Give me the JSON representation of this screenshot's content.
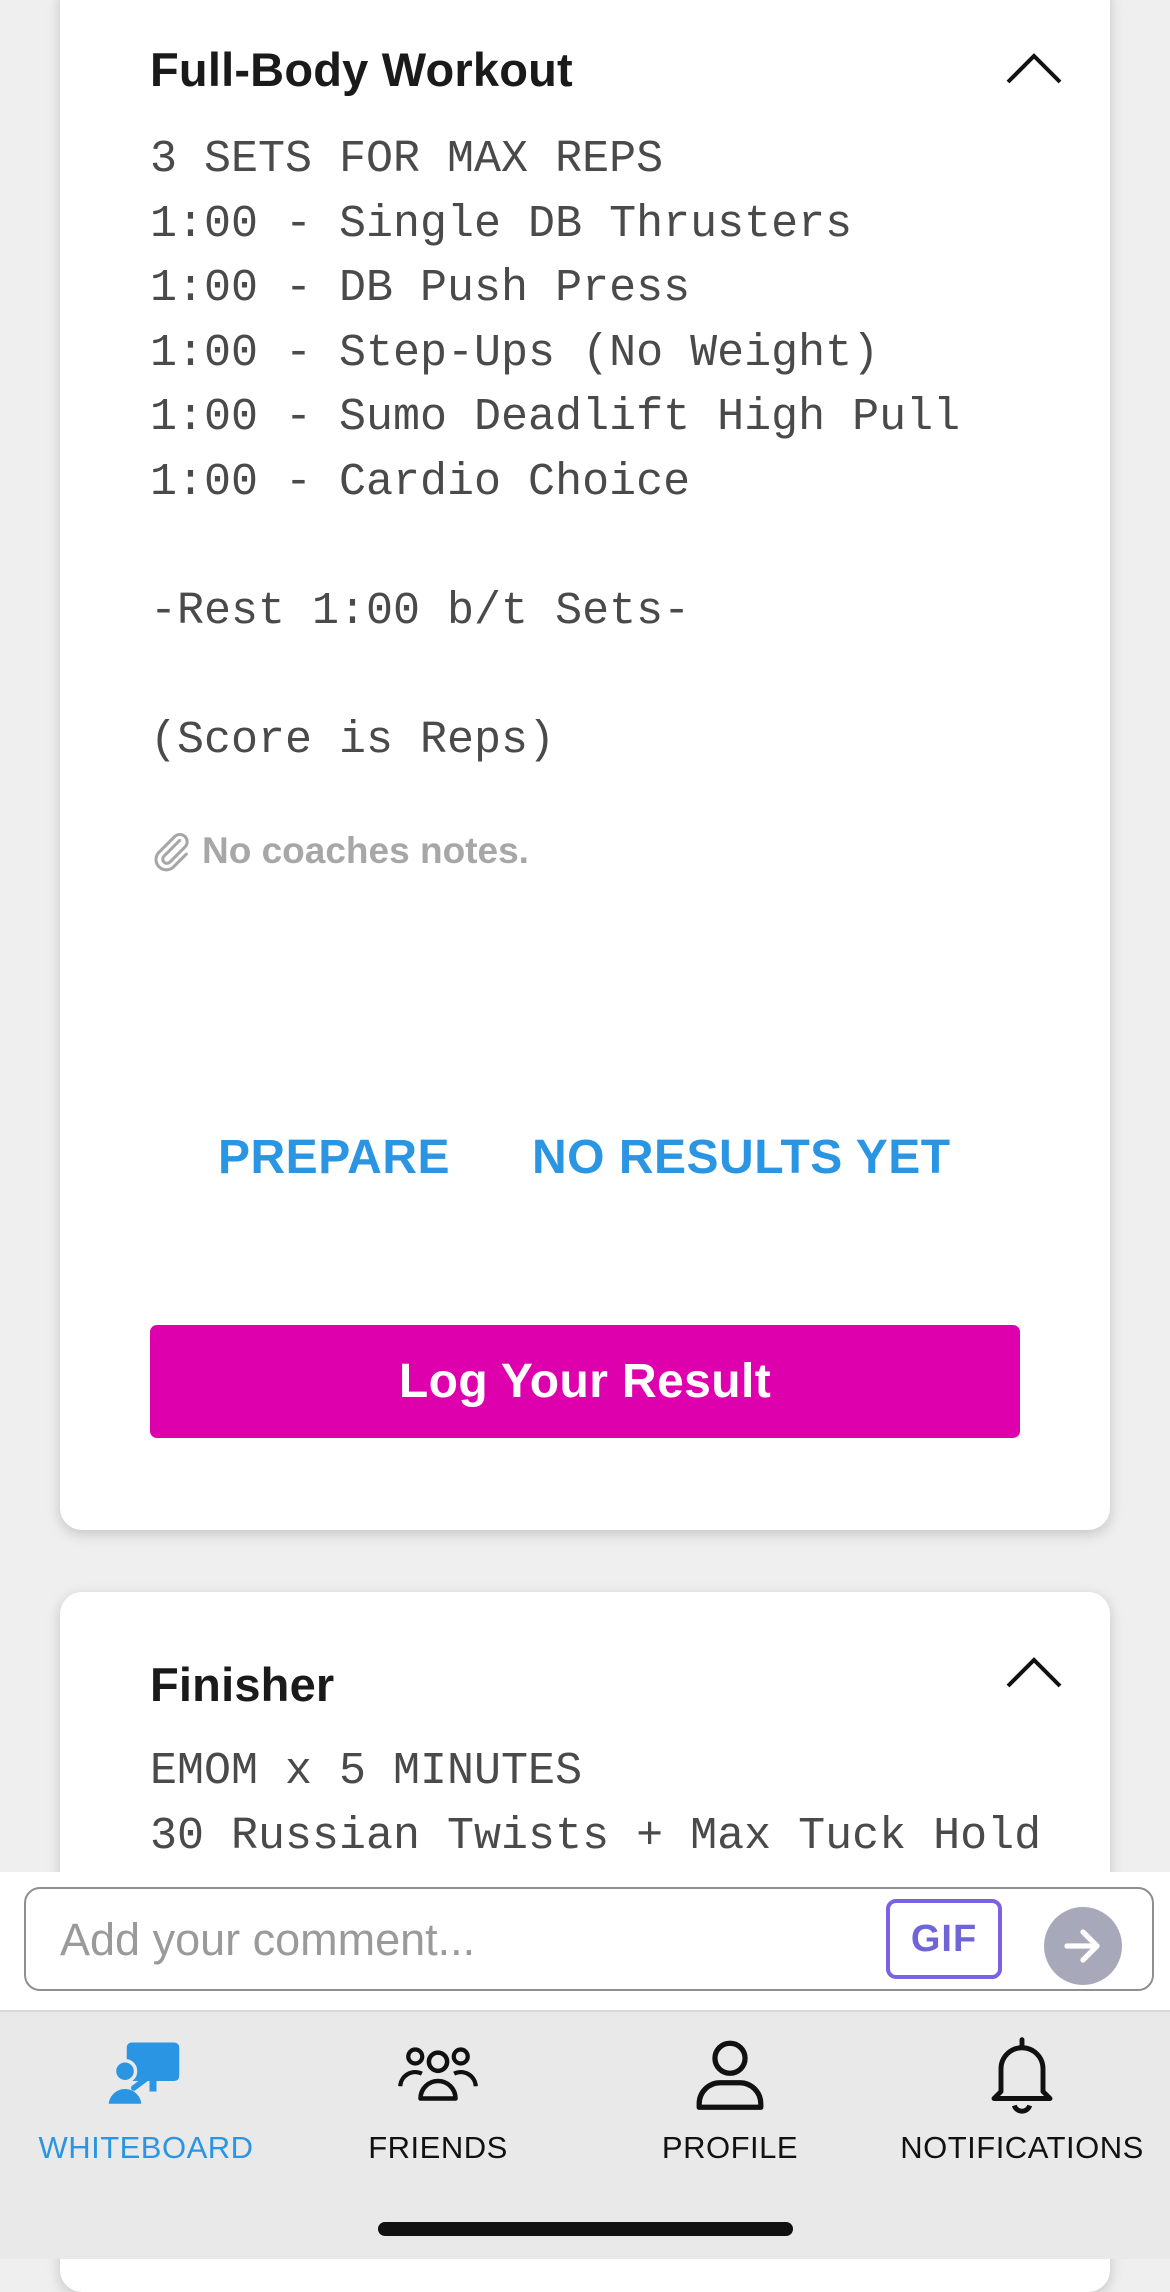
{
  "workout_card": {
    "title": "Full-Body Workout",
    "description": "3 SETS FOR MAX REPS\n1:00 - Single DB Thrusters\n1:00 - DB Push Press\n1:00 - Step-Ups (No Weight)\n1:00 - Sumo Deadlift High Pull\n1:00 - Cardio Choice\n\n-Rest 1:00 b/t Sets-\n\n(Score is Reps)",
    "notes": "No coaches notes.",
    "prepare_label": "PREPARE",
    "results_label": "NO RESULTS YET",
    "log_button_label": "Log Your Result"
  },
  "finisher_card": {
    "title": "Finisher",
    "description": "EMOM x 5 MINUTES\n30 Russian Twists + Max Tuck Hold"
  },
  "comment": {
    "placeholder": "Add your comment...",
    "gif_label": "GIF"
  },
  "tabs": [
    {
      "label": "WHITEBOARD",
      "icon": "whiteboard-icon",
      "active": true
    },
    {
      "label": "FRIENDS",
      "icon": "friends-icon",
      "active": false
    },
    {
      "label": "PROFILE",
      "icon": "profile-icon",
      "active": false
    },
    {
      "label": "NOTIFICATIONS",
      "icon": "bell-icon",
      "active": false
    }
  ],
  "colors": {
    "accent_blue": "#2a95e2",
    "button_magenta": "#df00ad",
    "background": "#efefef"
  }
}
